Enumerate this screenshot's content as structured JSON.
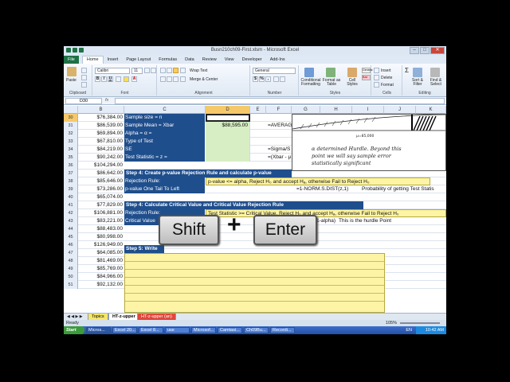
{
  "window": {
    "title": "Busn210ch09-First.xlsm - Microsoft Excel",
    "controls": [
      "–",
      "□",
      "✕"
    ]
  },
  "ribbon_tabs": [
    "File",
    "Home",
    "Insert",
    "Page Layout",
    "Formulas",
    "Data",
    "Review",
    "View",
    "Developer",
    "Add-Ins"
  ],
  "ribbon": {
    "paste_label": "Paste",
    "font_name": "Calibri",
    "font_size": "11",
    "wrap_text": "Wrap Text",
    "merge_center": "Merge & Center",
    "number_format": "General",
    "conditional_formatting": "Conditional Formatting",
    "format_as_table": "Format as Table",
    "cell_styles": "Cell Styles",
    "insert": "Insert",
    "delete": "Delete",
    "format": "Format",
    "sort_filter": "Sort & Filter",
    "find_select": "Find & Select",
    "sigma": "Σ",
    "groups": [
      "Clipboard",
      "Font",
      "Alignment",
      "Number",
      "Styles",
      "Cells",
      "Editing"
    ],
    "cell_format_top": "General",
    "cell_format_bottom": "Bad"
  },
  "formula_bar": {
    "name_box": "D30",
    "fx": "fx",
    "content": ""
  },
  "columns": [
    "B",
    "C",
    "D",
    "E",
    "F",
    "G",
    "H",
    "I",
    "J",
    "K"
  ],
  "rows": [
    {
      "n": "30",
      "val": "$76,384.00",
      "label": "Sample size = n",
      "d": "",
      "note": ""
    },
    {
      "n": "31",
      "val": "$86,539.00",
      "label": "Sample Mean = Xbar",
      "d": "$88,595.00",
      "note": "=AVERAG"
    },
    {
      "n": "32",
      "val": "$69,894.00",
      "label": "Alpha = α =",
      "d": "",
      "note": ""
    },
    {
      "n": "33",
      "val": "$67,810.00",
      "label": "Type of Test",
      "d": "",
      "note": ""
    },
    {
      "n": "34",
      "val": "$84,219.00",
      "label": "SE",
      "d": "",
      "note": "=Sigma/S"
    },
    {
      "n": "35",
      "val": "$90,242.00",
      "label": "Test Statistic = z =",
      "d": "",
      "note": "=(Xbar - μ"
    },
    {
      "n": "36",
      "val": "$104,294.00"
    },
    {
      "n": "37",
      "val": "$86,642.00"
    },
    {
      "n": "38",
      "val": "$85,646.00"
    },
    {
      "n": "39",
      "val": "$73,286.00"
    },
    {
      "n": "40",
      "val": "$65,074.00"
    },
    {
      "n": "41",
      "val": "$77,829.00"
    },
    {
      "n": "42",
      "val": "$106,881.00"
    },
    {
      "n": "43",
      "val": "$83,221.00"
    },
    {
      "n": "44",
      "val": "$88,483.00"
    },
    {
      "n": "45",
      "val": "$80,998.00"
    },
    {
      "n": "46",
      "val": "$126,949.00"
    },
    {
      "n": "47",
      "val": "$64,085.00"
    },
    {
      "n": "48",
      "val": "$81,469.00"
    },
    {
      "n": "49",
      "val": "$85,769.00"
    },
    {
      "n": "50",
      "val": "$84,966.00"
    },
    {
      "n": "51",
      "val": "$92,132.00"
    }
  ],
  "step4a": {
    "header": "Step 4: Create p-value Rejection Rule and calculate p-value",
    "rule_label": "Rejection Rule:",
    "rule_text": "p-value <= alpha, Reject H₀ and accept Hₐ, otherwise Fail to Reject H₀",
    "pvalue_label": "p-value One Tail To Left",
    "pvalue_formula": "=1-NORM.S.DIST(z,1)",
    "pvalue_note": "Probability of getting Test Statis"
  },
  "step4b": {
    "header": "Step 4: Calculate Critical Value and Critical Value Rejection Rule",
    "rule_label": "Rejection Rule:",
    "rule_text": "Test Statistic >= Critical Value, Reject H₀ and accept Hₐ, otherwise Fail to Reject H₀",
    "cv_label": "Critical Value",
    "cv_formula": "S.INV(1-alpha)",
    "cv_note": "This is the hurdle Point"
  },
  "step5": {
    "header": "Step 5: Write"
  },
  "sketch": {
    "mu_label": "μ=85,000",
    "handwriting": [
      "α determined Hurdle. Beyond this",
      "point we will say sample error",
      "statistically significant"
    ]
  },
  "keys": {
    "shift": "Shift",
    "plus": "+",
    "enter": "Enter"
  },
  "sheet_tabs": [
    "Topics",
    "HT-z-upper",
    "HT-z-upper (an)"
  ],
  "status": {
    "ready": "Ready",
    "zoom": "105%"
  },
  "taskbar": {
    "start": "Start",
    "buttons": [
      "Micros...",
      "Excel 20...",
      "Excel 8...",
      "use",
      "Microsof...",
      "Camtasi...",
      "Ch09Bu...",
      "Recordi..."
    ],
    "lang": "EN",
    "time": "10:42 AM"
  }
}
